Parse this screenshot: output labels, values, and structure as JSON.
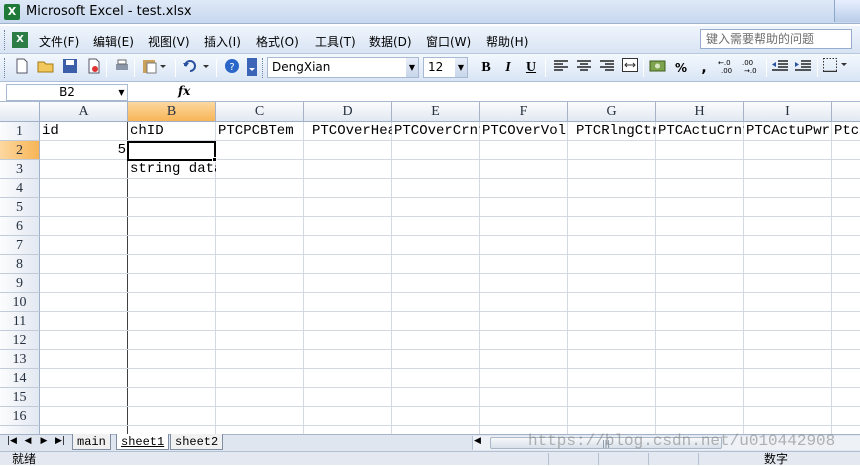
{
  "window": {
    "title": "Microsoft Excel - test.xlsx",
    "app_icon": "excel-icon"
  },
  "menu": {
    "items": [
      "文件(F)",
      "编辑(E)",
      "视图(V)",
      "插入(I)",
      "格式(O)",
      "工具(T)",
      "数据(D)",
      "窗口(W)",
      "帮助(H)"
    ],
    "help_placeholder": "键入需要帮助的问题"
  },
  "toolbar": {
    "font_name": "DengXian",
    "font_size": "12",
    "bold": "B",
    "italic": "I",
    "underline": "U",
    "percent": "%",
    "comma": ","
  },
  "formula_bar": {
    "name_box": "B2",
    "fx_label": "fx",
    "formula": ""
  },
  "grid": {
    "columns": [
      "A",
      "B",
      "C",
      "D",
      "E",
      "F",
      "G",
      "H",
      "I"
    ],
    "rows": [
      "1",
      "2",
      "3",
      "4",
      "5",
      "6",
      "7",
      "8",
      "9",
      "10",
      "11",
      "12",
      "13",
      "14",
      "15",
      "16"
    ],
    "selected_cell": "B2",
    "cells": {
      "A1": "id",
      "B1": "chID",
      "C1": "PTCPCBTem",
      "D1": "PTCOverHea",
      "E1": "PTCOverCrnt",
      "F1": "PTCOverVol",
      "G1": "PTCRlngCtr",
      "H1": "PTCActuCrnt",
      "I1": "PTCActuPwr",
      "J1": "Ptc",
      "A2": "5",
      "B3": "string data"
    }
  },
  "sheets": {
    "tabs": [
      "main",
      "sheet1",
      "sheet2"
    ],
    "active": "sheet1"
  },
  "status": {
    "left": "就绪",
    "right": "数字"
  },
  "watermark": "https://blog.csdn.net/u010442908"
}
